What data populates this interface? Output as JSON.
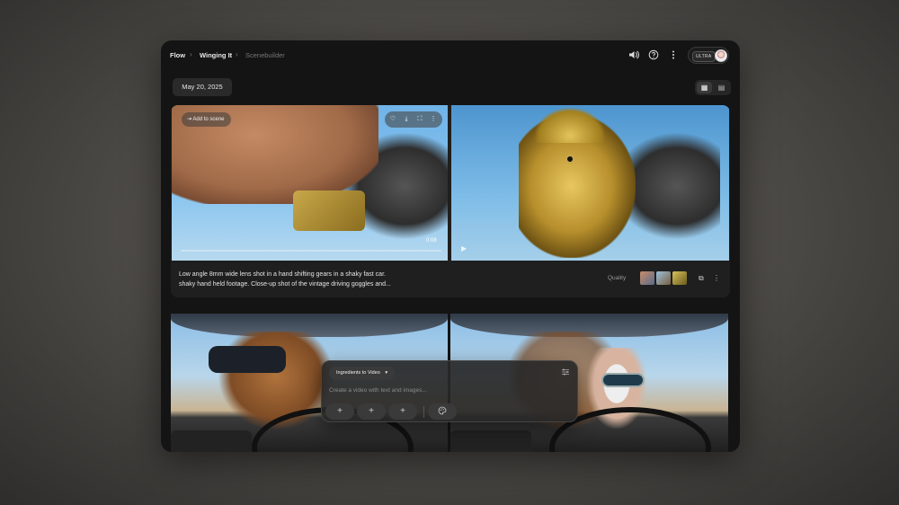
{
  "breadcrumb": {
    "items": [
      "Flow",
      "Winging It",
      "Scenebuilder"
    ],
    "separator": "›"
  },
  "header_icons": {
    "volume": "volume-icon",
    "help": "help-icon",
    "more": "more-vert-icon"
  },
  "account": {
    "badge": "ULTRA"
  },
  "date_label": "May 20, 2025",
  "view_toggle": {
    "grid_icon": "▦",
    "list_icon": "▤"
  },
  "clip_card": {
    "add_to_scene": "Add to scene",
    "timecode": "0:08",
    "prompt_line1": "Low angle 8mm wide lens shot in a hand shifting gears in a shaky fast car.",
    "prompt_line2": "shaky hand held footage. Close-up shot of the vintage driving goggles and...",
    "quality_label": "Quality",
    "actions": {
      "favorite": "♡",
      "download": "⤓",
      "fullscreen": "⛶",
      "more": "⋮"
    }
  },
  "composer": {
    "mode_label": "Ingredients to Video",
    "mode_caret": "▾",
    "placeholder": "Create a video with text and images...",
    "add_symbol": "+",
    "tune_symbol": "⚙"
  }
}
